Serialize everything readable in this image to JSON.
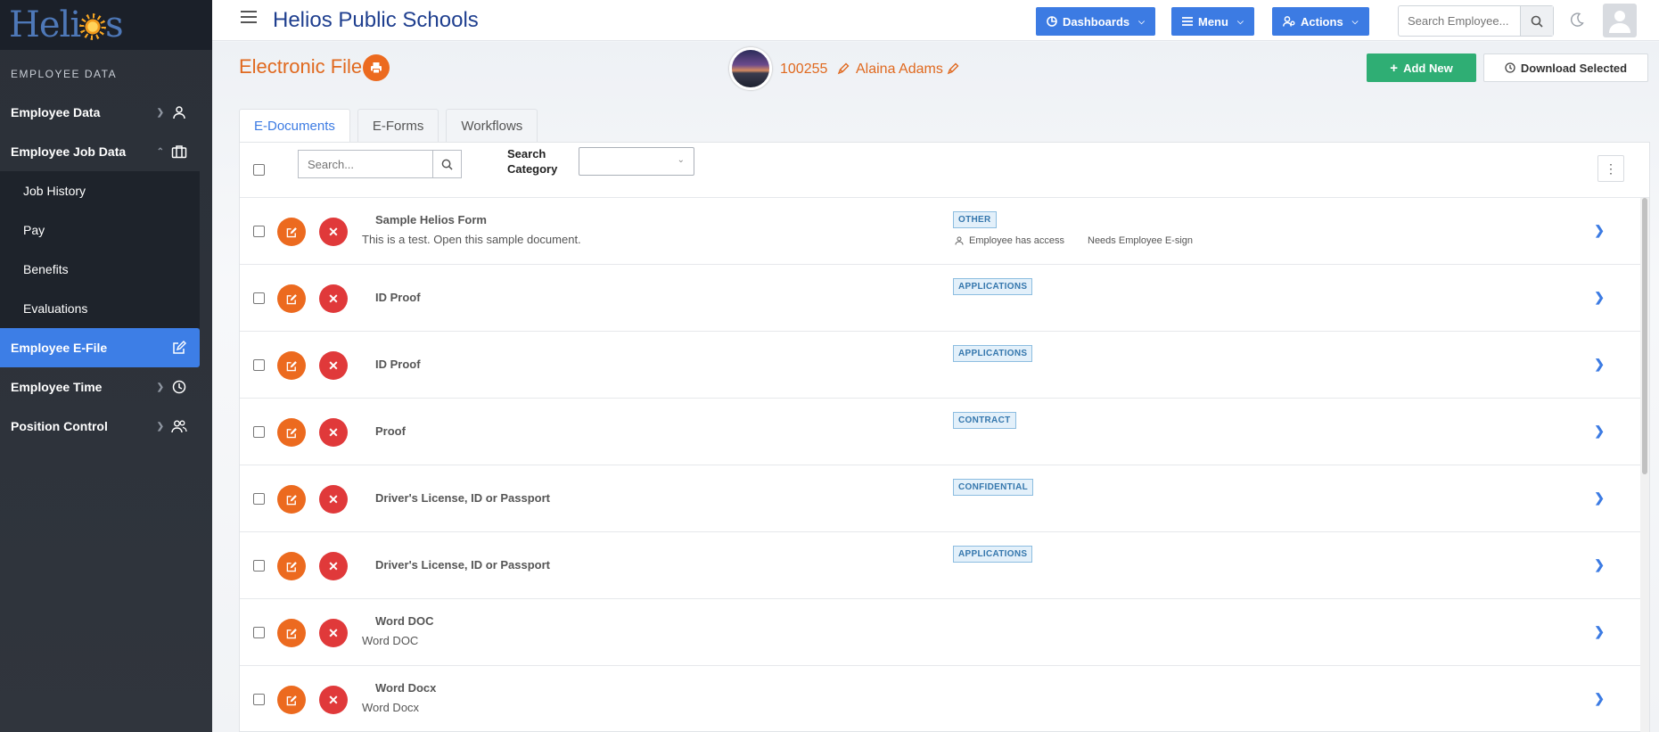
{
  "app": {
    "logo_text_left": "Heli",
    "logo_text_right": "s",
    "brand": "Helios Public Schools"
  },
  "sidebar": {
    "heading": "EMPLOYEE DATA",
    "items": [
      {
        "label": "Employee Data",
        "icon": "person-icon"
      },
      {
        "label": "Employee Job Data",
        "icon": "briefcase-icon"
      },
      {
        "label": "Job History"
      },
      {
        "label": "Pay"
      },
      {
        "label": "Benefits"
      },
      {
        "label": "Evaluations"
      },
      {
        "label": "Employee E-File",
        "icon": "edit-icon"
      },
      {
        "label": "Employee Time",
        "icon": "clock-icon"
      },
      {
        "label": "Position Control",
        "icon": "people-icon"
      }
    ]
  },
  "topbar": {
    "dashboards_label": "Dashboards",
    "menu_label": "Menu",
    "actions_label": "Actions",
    "search_placeholder": "Search Employee..."
  },
  "page": {
    "title": "Electronic File",
    "employee_id": "100255",
    "employee_name": "Alaina Adams",
    "add_new_label": "Add New",
    "download_label": "Download Selected",
    "tabs": [
      {
        "label": "E-Documents",
        "active": true
      },
      {
        "label": "E-Forms"
      },
      {
        "label": "Workflows"
      }
    ],
    "search_placeholder": "Search...",
    "category_label_line1": "Search",
    "category_label_line2": "Category",
    "category_value": ""
  },
  "documents": [
    {
      "title": "Sample Helios Form",
      "desc": "This is a test. Open this sample document.",
      "badge": "OTHER",
      "access": "Employee has access",
      "esign": "Needs Employee E-sign"
    },
    {
      "title": "ID Proof",
      "desc": "",
      "badge": "APPLICATIONS"
    },
    {
      "title": "ID Proof",
      "desc": "",
      "badge": "APPLICATIONS"
    },
    {
      "title": "Proof",
      "desc": "",
      "badge": "CONTRACT"
    },
    {
      "title": "Driver's License, ID or Passport",
      "desc": "",
      "badge": "CONFIDENTIAL"
    },
    {
      "title": "Driver's License, ID or Passport",
      "desc": "",
      "badge": "APPLICATIONS"
    },
    {
      "title": "Word DOC",
      "desc": "Word DOC",
      "badge": ""
    },
    {
      "title": "Word Docx",
      "desc": "Word Docx",
      "badge": ""
    }
  ],
  "colors": {
    "accent": "#3c7be3",
    "orange": "#ec6a1f",
    "danger": "#e0393a",
    "success": "#2fae74",
    "sidebar": "#2b3038"
  }
}
